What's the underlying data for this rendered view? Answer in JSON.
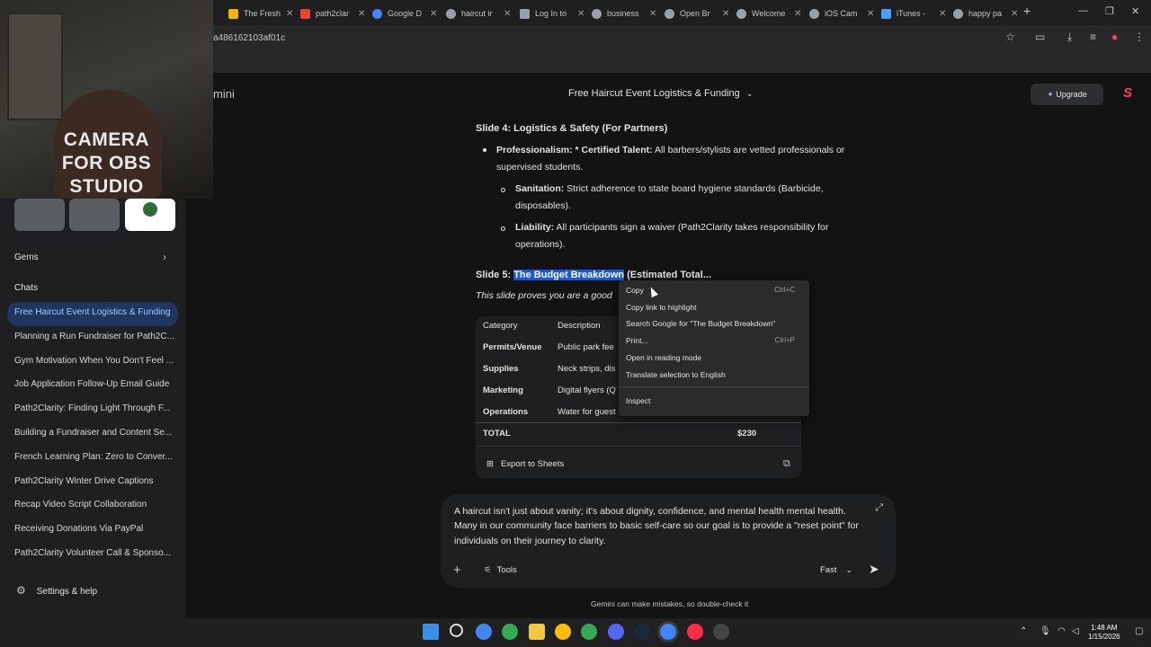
{
  "browser": {
    "tabs": [
      {
        "label": "The Fresh",
        "color": "#f4b400"
      },
      {
        "label": "path2clar",
        "color": "#ea4335"
      },
      {
        "label": "Google D",
        "color": "#4285f4"
      },
      {
        "label": "haircut ir",
        "color": "#9aa0a6"
      },
      {
        "label": "Log In to",
        "color": "#9aa0a6"
      },
      {
        "label": "business",
        "color": "#9aa0a6"
      },
      {
        "label": "Open Br",
        "color": "#9aa0a6"
      },
      {
        "label": "Welcome",
        "color": "#9aa0a6"
      },
      {
        "label": "iOS Cam",
        "color": "#9aa0a6"
      },
      {
        "label": "iTunes -",
        "color": "#4a9eff"
      },
      {
        "label": "happy pa",
        "color": "#9aa0a6"
      }
    ],
    "new_tab": "+",
    "url": "a486162103af01c"
  },
  "camera_overlay": {
    "caption_lines": [
      "CAMERA",
      "FOR OBS",
      "STUDIO"
    ]
  },
  "app": {
    "logo_text": "mini"
  },
  "sidebar": {
    "gems_label": "Gems",
    "chats_label": "Chats",
    "chats": [
      "Free Haircut Event Logistics & Funding",
      "Planning a Run Fundraiser for Path2C...",
      "Gym Motivation When You Don't Feel ...",
      "Job Application Follow-Up Email Guide",
      "Path2Clarity: Finding Light Through F...",
      "Building a Fundraiser and Content Se...",
      "French Learning Plan: Zero to Conver...",
      "Path2Clarity Winter Drive Captions",
      "Recap Video Script Collaboration",
      "Receiving Donations Via PayPal",
      "Path2Clarity Volunteer Call & Sponso..."
    ],
    "settings_label": "Settings & help"
  },
  "header": {
    "title": "Free Haircut Event Logistics & Funding",
    "upgrade_label": "Upgrade"
  },
  "content": {
    "slide4_heading": "Slide 4: Logistics & Safety (For Partners)",
    "b1_bold": "Professionalism: * Certified Talent:",
    "b1_line1": " All barbers/stylists are vetted professionals or",
    "b1_line2": "supervised students.",
    "b2_bold": "Sanitation:",
    "b2_line1": " Strict adherence to state board hygiene standards (Barbicide,",
    "b2_line2": "disposables).",
    "b3_bold": "Liability:",
    "b3_line1": " All participants sign a waiver (Path2Clarity takes responsibility for",
    "b3_line2": "operations).",
    "slide5_prefix": "Slide 5: ",
    "slide5_highlight": "The Budget Breakdown",
    "slide5_rest": " (Estimated Total...",
    "slide5_sub": "This slide proves you are a good"
  },
  "table": {
    "headers": [
      "Category",
      "Description"
    ],
    "rows": [
      {
        "category": "Permits/Venue",
        "description": "Public park fee"
      },
      {
        "category": "Supplies",
        "description": "Neck strips, dis"
      },
      {
        "category": "Marketing",
        "description": "Digital flyers (Q"
      },
      {
        "category": "Operations",
        "description": "Water for guest"
      }
    ],
    "total_label": "TOTAL",
    "total_value": "$230",
    "export_label": "Export to Sheets"
  },
  "context_menu": {
    "items": [
      {
        "label": "Copy",
        "shortcut": "Ctrl+C"
      },
      {
        "label": "Copy link to highlight",
        "shortcut": ""
      },
      {
        "label": "Search Google for \"The Budget Breakdown\"",
        "shortcut": ""
      },
      {
        "label": "Print...",
        "shortcut": "Ctrl+P"
      },
      {
        "label": "Open in reading mode",
        "shortcut": ""
      },
      {
        "label": "Translate selection to English",
        "shortcut": ""
      }
    ],
    "inspect_label": "Inspect"
  },
  "prompt": {
    "text": "A haircut isn't just about vanity; it's about dignity, confidence, and mental health mental health. Many in our community face barriers to basic self-care so our goal is to provide a \"reset point\" for individuals on their journey to clarity.",
    "tools_label": "Tools",
    "mode_label": "Fast"
  },
  "disclaimer": "Gemini can make mistakes, so double-check it",
  "taskbar": {
    "time": "1:48 AM",
    "date": "1/15/2026"
  }
}
